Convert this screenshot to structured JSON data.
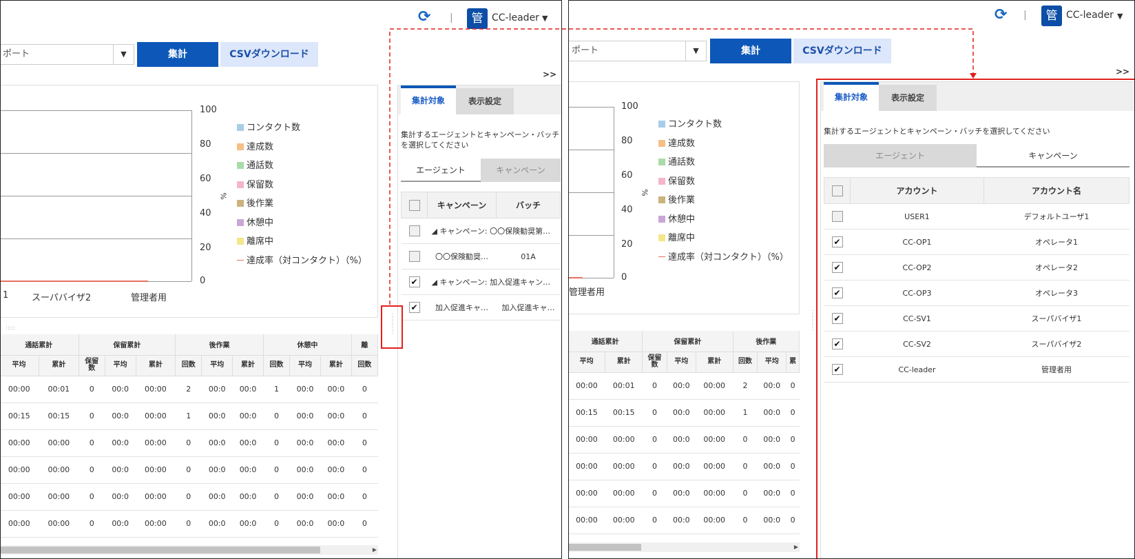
{
  "header": {
    "refresh_icon": "refresh-icon",
    "user_initial": "管",
    "user_name": "CC-leader",
    "dropdown_icon": "chevron-down-icon"
  },
  "toolbar": {
    "report_select_value": "ポート",
    "aggregate_button": "集計",
    "csv_button": "CSVダウンロード"
  },
  "expand_label": ">>",
  "chart": {
    "type": "bar",
    "y_ticks": [
      "100",
      "80",
      "60",
      "40",
      "20",
      "0"
    ],
    "y_axis_label": "%",
    "legend": [
      {
        "label": "コンタクト数",
        "color": "#a8cde8"
      },
      {
        "label": "達成数",
        "color": "#f6bf86"
      },
      {
        "label": "通話数",
        "color": "#a9dba9"
      },
      {
        "label": "保留数",
        "color": "#f4b6c8"
      },
      {
        "label": "後作業",
        "color": "#cbb37c"
      },
      {
        "label": "休憩中",
        "color": "#caa6d6"
      },
      {
        "label": "離席中",
        "color": "#f5e68a"
      },
      {
        "label": "達成率（対コンタクト）（%）",
        "color": "#e87060"
      }
    ],
    "left_categories": [
      "1",
      "スーパバイザ2",
      "管理者用"
    ],
    "right_categories": [
      "管理者用"
    ]
  },
  "chart_data": {
    "type": "bar",
    "categories": [
      "1",
      "スーパバイザ2",
      "管理者用"
    ],
    "ylim": [
      0,
      100
    ],
    "ylabel": "%",
    "series": [
      {
        "name": "コンタクト数",
        "values": [
          0,
          0,
          0
        ]
      },
      {
        "name": "達成数",
        "values": [
          0,
          0,
          0
        ]
      },
      {
        "name": "通話数",
        "values": [
          0,
          0,
          0
        ]
      },
      {
        "name": "保留数",
        "values": [
          0,
          0,
          0
        ]
      },
      {
        "name": "後作業",
        "values": [
          0,
          0,
          0
        ]
      },
      {
        "name": "休憩中",
        "values": [
          0,
          0,
          0
        ]
      },
      {
        "name": "離席中",
        "values": [
          0,
          0,
          0
        ]
      },
      {
        "name": "達成率（対コンタクト）（%）",
        "values": [
          0,
          0,
          0
        ]
      }
    ],
    "legend_position": "right"
  },
  "grid": {
    "left": {
      "groups": [
        "通話累計",
        "保留累計",
        "後作業",
        "休憩中",
        "離"
      ],
      "columns": [
        "平均",
        "累計",
        "保留\n数",
        "平均",
        "累計",
        "回数",
        "平均",
        "累計",
        "回数",
        "平均",
        "累計",
        "回数"
      ],
      "rows": [
        [
          "00:00",
          "00:01",
          "0",
          "00:0",
          "00:00",
          "2",
          "00:0",
          "00:0",
          "1",
          "00:0",
          "00:0",
          "0"
        ],
        [
          "00:15",
          "00:15",
          "0",
          "00:0",
          "00:00",
          "1",
          "00:0",
          "00:0",
          "0",
          "00:0",
          "00:0",
          "0"
        ],
        [
          "00:00",
          "00:00",
          "0",
          "00:0",
          "00:00",
          "0",
          "00:0",
          "00:0",
          "0",
          "00:0",
          "00:0",
          "0"
        ],
        [
          "00:00",
          "00:00",
          "0",
          "00:0",
          "00:00",
          "0",
          "00:0",
          "00:0",
          "0",
          "00:0",
          "00:0",
          "0"
        ],
        [
          "00:00",
          "00:00",
          "0",
          "00:0",
          "00:00",
          "0",
          "00:0",
          "00:0",
          "0",
          "00:0",
          "00:0",
          "0"
        ],
        [
          "00:00",
          "00:00",
          "0",
          "00:0",
          "00:00",
          "0",
          "00:0",
          "00:0",
          "0",
          "00:0",
          "00:0",
          "0"
        ]
      ]
    },
    "right": {
      "groups": [
        "通話累計",
        "保留累計",
        "後作業"
      ],
      "columns": [
        "平均",
        "累計",
        "保留\n数",
        "平均",
        "累計",
        "回数",
        "平均",
        "累"
      ],
      "rows": [
        [
          "00:00",
          "00:01",
          "0",
          "00:0",
          "00:00",
          "2",
          "00:0",
          "0"
        ],
        [
          "00:15",
          "00:15",
          "0",
          "00:0",
          "00:00",
          "1",
          "00:0",
          "0"
        ],
        [
          "00:00",
          "00:00",
          "0",
          "00:0",
          "00:00",
          "0",
          "00:0",
          "0"
        ],
        [
          "00:00",
          "00:00",
          "0",
          "00:0",
          "00:00",
          "0",
          "00:0",
          "0"
        ],
        [
          "00:00",
          "00:00",
          "0",
          "00:0",
          "00:00",
          "0",
          "00:0",
          "0"
        ],
        [
          "00:00",
          "00:00",
          "0",
          "00:0",
          "00:00",
          "0",
          "00:0",
          "0"
        ]
      ]
    }
  },
  "side_panel": {
    "tabs": [
      "集計対象",
      "表示設定"
    ],
    "instruction": "集計するエージェントとキャンペーン・バッチを選択してください",
    "instruction_wrapped": "集計するエージェントとキャンペーン・バッチ\nを選択してください",
    "segments": [
      "エージェント",
      "キャンペーン"
    ],
    "campaign_table": {
      "headers": [
        "キャンペーン",
        "バッチ"
      ],
      "rows": [
        {
          "checked": false,
          "group": true,
          "campaign": "◢ キャンペーン: 〇〇保険勧奨第…",
          "batch": ""
        },
        {
          "checked": false,
          "group": false,
          "campaign": "〇〇保険勧奨…",
          "batch": "01A"
        },
        {
          "checked": true,
          "group": true,
          "campaign": "◢ キャンペーン: 加入促進キャン…",
          "batch": ""
        },
        {
          "checked": true,
          "group": false,
          "campaign": "加入促進キャ…",
          "batch": "加入促進キャ…"
        }
      ]
    },
    "agent_table": {
      "headers": [
        "アカウント",
        "アカウント名"
      ],
      "rows": [
        {
          "checked": false,
          "account": "USER1",
          "name": "デフォルトユーザ1"
        },
        {
          "checked": true,
          "account": "CC-OP1",
          "name": "オペレータ1"
        },
        {
          "checked": true,
          "account": "CC-OP2",
          "name": "オペレータ2"
        },
        {
          "checked": true,
          "account": "CC-OP3",
          "name": "オペレータ3"
        },
        {
          "checked": true,
          "account": "CC-SV1",
          "name": "スーパバイザ1"
        },
        {
          "checked": true,
          "account": "CC-SV2",
          "name": "スーパバイザ2"
        },
        {
          "checked": true,
          "account": "CC-leader",
          "name": "管理者用"
        }
      ]
    }
  },
  "annotation_color": "#e0201c",
  "check_mark": "✔"
}
